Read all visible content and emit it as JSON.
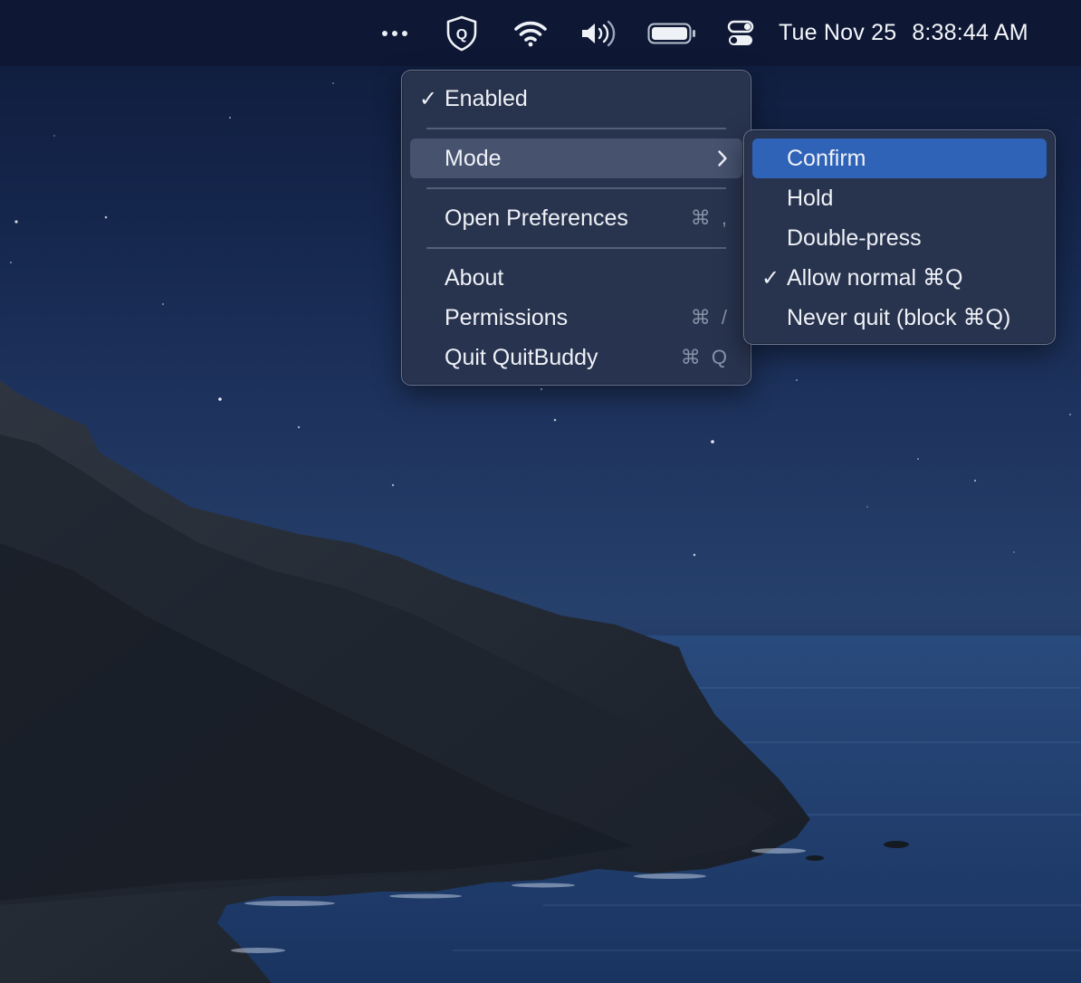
{
  "menubar": {
    "icons": [
      "more-dots-icon",
      "quitbuddy-shield-icon",
      "wifi-icon",
      "volume-icon",
      "battery-icon",
      "control-center-icon"
    ],
    "shield_letter": "Q",
    "date": "Tue Nov 25",
    "time": "8:38:44 AM"
  },
  "main_menu": {
    "enabled": {
      "check": "✓",
      "label": "Enabled"
    },
    "mode": {
      "label": "Mode"
    },
    "open_preferences": {
      "label": "Open Preferences",
      "shortcut": "⌘ ,"
    },
    "about": {
      "label": "About"
    },
    "permissions": {
      "label": "Permissions",
      "shortcut": "⌘ /"
    },
    "quit": {
      "label": "Quit QuitBuddy",
      "shortcut": "⌘ Q"
    }
  },
  "mode_submenu": {
    "items": [
      {
        "label": "Confirm",
        "check": "",
        "selected": true
      },
      {
        "label": "Hold",
        "check": ""
      },
      {
        "label": "Double-press",
        "check": ""
      },
      {
        "label": "Allow normal ⌘Q",
        "check": "✓"
      },
      {
        "label": "Never quit (block ⌘Q)",
        "check": ""
      }
    ]
  },
  "colors": {
    "highlight": "#2f63b8",
    "menu_background": "#29344e",
    "shortcut_text": "#8792a8"
  }
}
